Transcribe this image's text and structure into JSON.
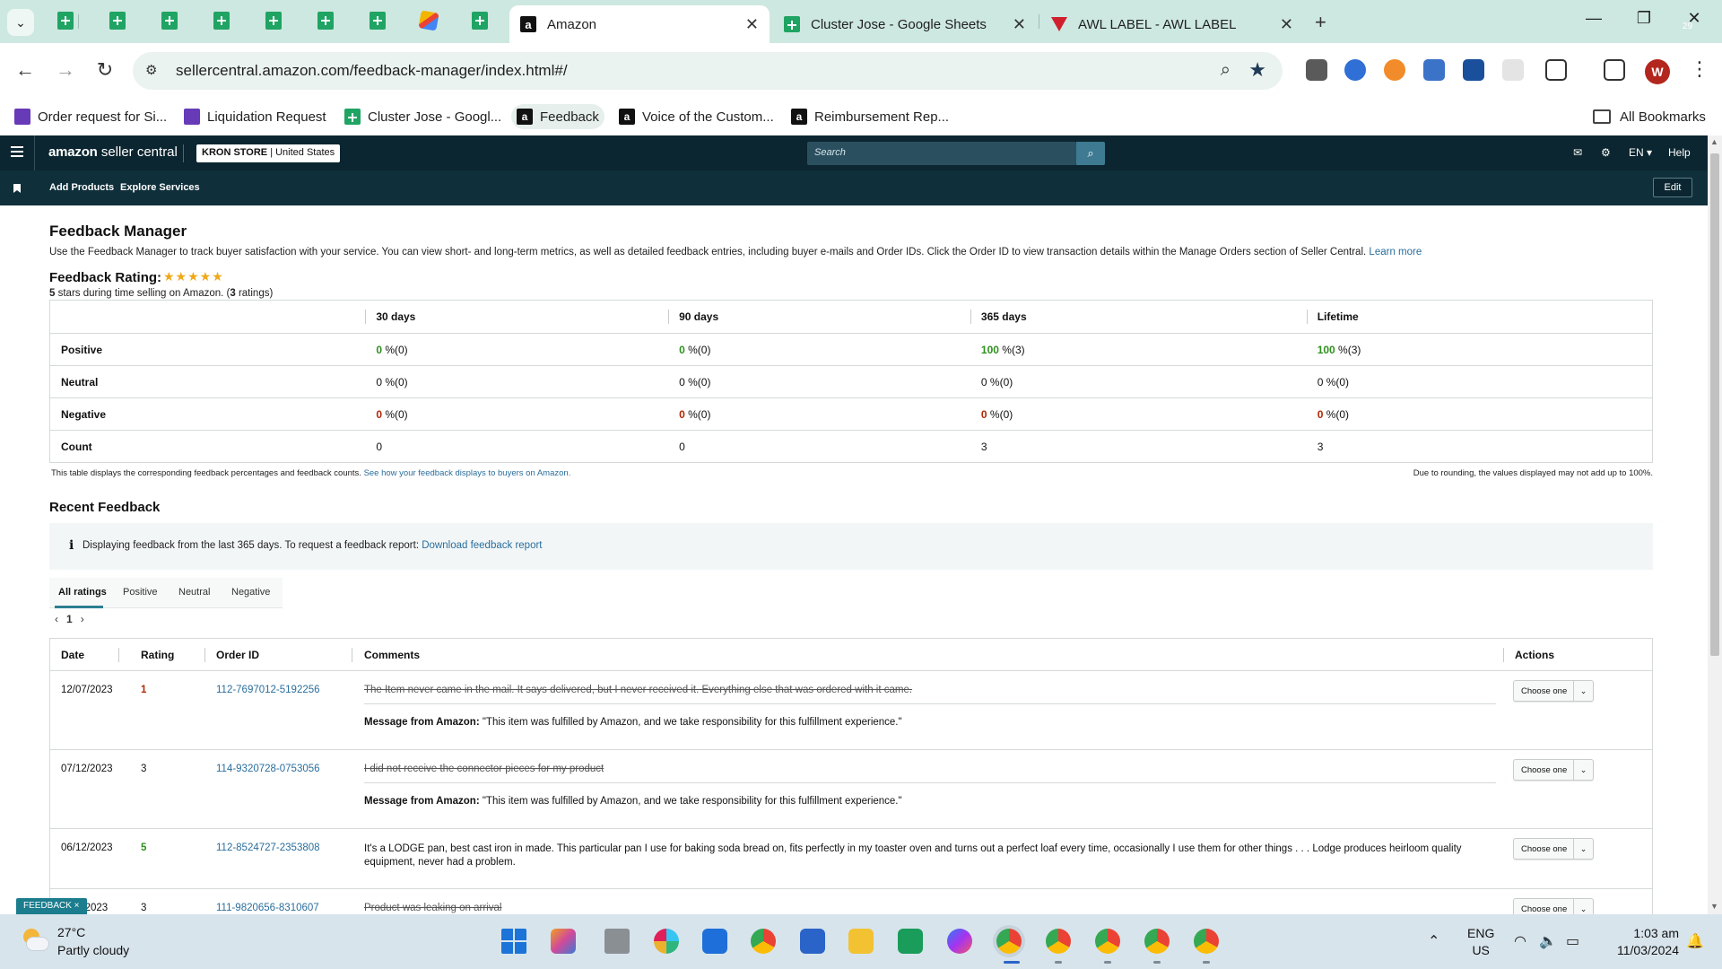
{
  "browser": {
    "tabs": [
      {
        "title": "Amazon",
        "active": true
      },
      {
        "title": "Cluster Jose - Google Sheets",
        "active": false
      },
      {
        "title": "AWL LABEL - AWL LABEL",
        "active": false
      }
    ],
    "url": "sellercentral.amazon.com/feedback-manager/index.html#/",
    "profile_initial": "W",
    "bookmarks": [
      "Order request for Si...",
      "Liquidation Request",
      "Cluster Jose - Googl...",
      "Feedback",
      "Voice of the Custom...",
      "Reimbursement Rep..."
    ],
    "all_bookmarks": "All Bookmarks",
    "tab_badge": "29"
  },
  "seller_central": {
    "logo_bold": "amazon",
    "logo_rest": " seller central",
    "store_name": "KRON STORE",
    "store_region": " | United States",
    "search_placeholder": "Search",
    "lang": "EN",
    "help": "Help",
    "nav": [
      "Add Products",
      "Explore Services"
    ],
    "edit": "Edit"
  },
  "feedback_manager": {
    "title": "Feedback Manager",
    "description": "Use the Feedback Manager to track buyer satisfaction with your service. You can view short- and long-term metrics, as well as detailed feedback entries, including buyer e-mails and Order IDs. Click the Order ID to view transaction details within the Manage Orders section of Seller Central.",
    "learn_more": "Learn more",
    "rating_label": "Feedback Rating:",
    "stars": "★★★★★",
    "rating_stars_value": 5,
    "rating_summary_pre": "5",
    "rating_summary_mid": " stars during time selling on Amazon. (",
    "rating_summary_count": "3",
    "rating_summary_post": " ratings)",
    "table": {
      "columns": [
        "30 days",
        "90 days",
        "365 days",
        "Lifetime"
      ],
      "rows": [
        {
          "label": "Positive",
          "cells": [
            [
              "0",
              " %(0)"
            ],
            [
              "0",
              " %(0)"
            ],
            [
              "100",
              " %(3)"
            ],
            [
              "100",
              " %(3)"
            ]
          ]
        },
        {
          "label": "Neutral",
          "cells": [
            [
              "0",
              " %(0)"
            ],
            [
              "0",
              " %(0)"
            ],
            [
              "0",
              " %(0)"
            ],
            [
              "0",
              " %(0)"
            ]
          ]
        },
        {
          "label": "Negative",
          "cells": [
            [
              "0",
              " %(0)"
            ],
            [
              "0",
              " %(0)"
            ],
            [
              "0",
              " %(0)"
            ],
            [
              "0",
              " %(0)"
            ]
          ]
        },
        {
          "label": "Count",
          "cells": [
            [
              "0",
              ""
            ],
            [
              "0",
              ""
            ],
            [
              "3",
              ""
            ],
            [
              "3",
              ""
            ]
          ]
        }
      ]
    },
    "note_left": "This table displays the corresponding feedback percentages and feedback counts.",
    "note_link": "See how your feedback displays to buyers on Amazon.",
    "note_right": "Due to rounding, the values displayed may not add up to 100%."
  },
  "recent_feedback": {
    "title": "Recent Feedback",
    "info_icon": "i",
    "info": "Displaying feedback from the last 365 days. To request a feedback report:",
    "info_link": "Download feedback report",
    "tabs": [
      "All ratings",
      "Positive",
      "Neutral",
      "Negative"
    ],
    "page": "1",
    "columns": [
      "Date",
      "Rating",
      "Order ID",
      "Comments",
      "Actions"
    ],
    "action_label": "Choose one",
    "message_label": "Message from Amazon:",
    "message_text": " \"This item was fulfilled by Amazon, and we take responsibility for this fulfillment experience.\"",
    "rows": [
      {
        "date": "12/07/2023",
        "rating": "1",
        "order_id": "112-7697012-5192256",
        "comment": "The Item never came in the mail. It says delivered, but I never received it. Everything else that was ordered with it came.",
        "struck": true,
        "message": true
      },
      {
        "date": "07/12/2023",
        "rating": "3",
        "order_id": "114-9320728-0753056",
        "comment": "I did not receive the connector pieces for my product",
        "struck": true,
        "message": true
      },
      {
        "date": "06/12/2023",
        "rating": "5",
        "order_id": "112-8524727-2353808",
        "comment": "It's a LODGE pan, best cast iron in made. This particular pan I use for baking soda bread on, fits perfectly in my toaster oven and turns out a perfect loaf every time, occasionally I use them for other things . . . Lodge produces heirloom quality equipment, never had a problem.",
        "struck": false,
        "message": false
      },
      {
        "date": "1/2023",
        "rating": "3",
        "order_id": "111-9820656-8310607",
        "comment": "Product was leaking on arrival",
        "struck": true,
        "message": false
      }
    ],
    "feedback_tag": "FEEDBACK ×"
  },
  "taskbar": {
    "temp": "27°C",
    "condition": "Partly cloudy",
    "lang_1": "ENG",
    "lang_2": "US",
    "time": "1:03 am",
    "date": "11/03/2024"
  },
  "colors": {
    "positive": "#2f8f1f",
    "negative": "#b12704",
    "link": "#2a6e9c",
    "header_bg": "#0f2f3a",
    "tabstrip_bg": "#cde8e0"
  }
}
